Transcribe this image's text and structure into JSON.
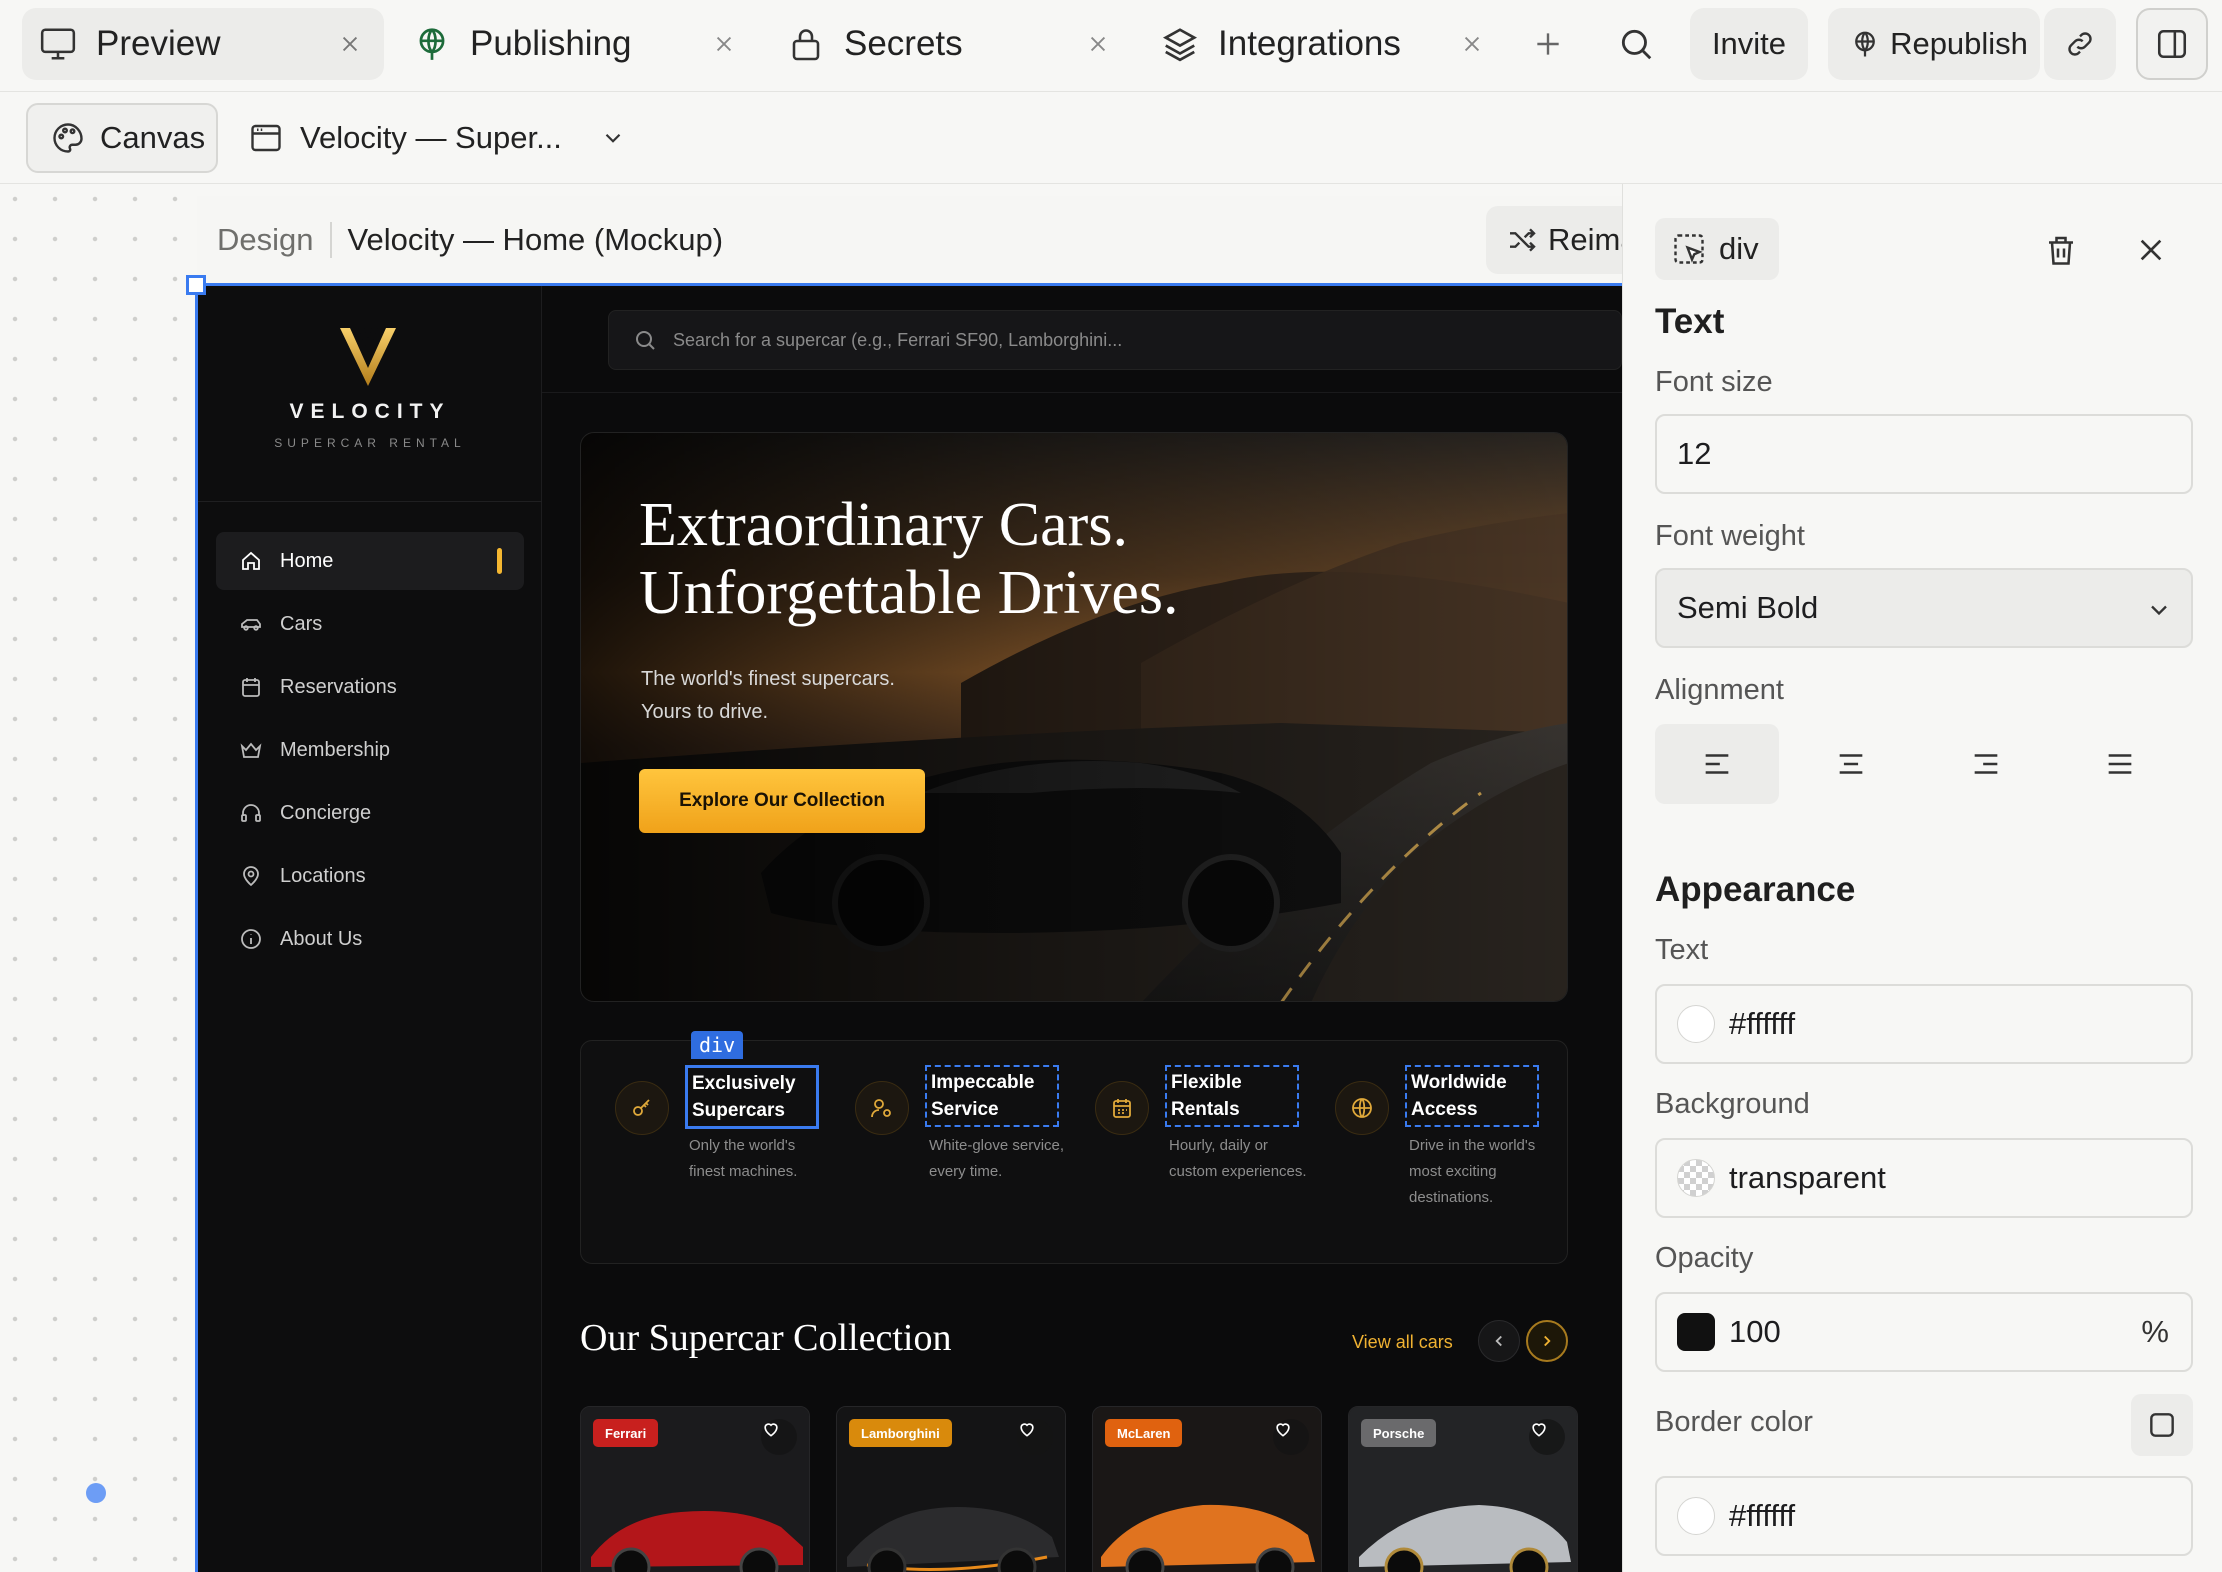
{
  "tabs": [
    {
      "label": "Preview",
      "icon": "monitor-icon",
      "active": true
    },
    {
      "label": "Publishing",
      "icon": "globe-icon",
      "active": false
    },
    {
      "label": "Secrets",
      "icon": "lock-icon",
      "active": false
    },
    {
      "label": "Integrations",
      "icon": "layers-icon",
      "active": false
    }
  ],
  "topbar": {
    "invite_label": "Invite",
    "republish_label": "Republish"
  },
  "subbar": {
    "canvas_label": "Canvas",
    "page_label": "Velocity — Super..."
  },
  "frame": {
    "crumb_parent": "Design",
    "crumb_current": "Velocity — Home (Mockup)",
    "reimagine_label": "Reima"
  },
  "site": {
    "brand_name": "VELOCITY",
    "brand_tagline": "SUPERCAR RENTAL",
    "accent_color": "#f5b731",
    "nav": [
      {
        "label": "Home",
        "icon": "home-icon",
        "active": true
      },
      {
        "label": "Cars",
        "icon": "car-icon",
        "active": false
      },
      {
        "label": "Reservations",
        "icon": "calendar-icon",
        "active": false
      },
      {
        "label": "Membership",
        "icon": "crown-icon",
        "active": false
      },
      {
        "label": "Concierge",
        "icon": "headphones-icon",
        "active": false
      },
      {
        "label": "Locations",
        "icon": "map-pin-icon",
        "active": false
      },
      {
        "label": "About Us",
        "icon": "info-icon",
        "active": false
      }
    ],
    "search_placeholder": "Search for a supercar (e.g., Ferrari SF90, Lamborghini...",
    "hero": {
      "title_line1": "Extraordinary Cars.",
      "title_line2": "Unforgettable Drives.",
      "subtitle_line1": "The world's finest supercars.",
      "subtitle_line2": "Yours to drive.",
      "cta_label": "Explore Our Collection"
    },
    "features": [
      {
        "title": "Exclusively Supercars",
        "desc": "Only the world's finest machines.",
        "icon": "key-icon"
      },
      {
        "title": "Impeccable Service",
        "desc": "White-glove service, every time.",
        "icon": "user-gear-icon"
      },
      {
        "title": "Flexible Rentals",
        "desc": "Hourly, daily or custom experiences.",
        "icon": "calendar-icon"
      },
      {
        "title": "Worldwide Access",
        "desc": "Drive in the world's most exciting destinations.",
        "icon": "globe-icon"
      }
    ],
    "selected_tag": "div",
    "collection_title": "Our Supercar Collection",
    "view_all_label": "View all cars",
    "cars": [
      {
        "brand": "Ferrari",
        "badge_color": "#c8201e",
        "body_color": "#b3161a"
      },
      {
        "brand": "Lamborghini",
        "badge_color": "#d98a0c",
        "body_color": "#2b2b2d"
      },
      {
        "brand": "McLaren",
        "badge_color": "#e0620f",
        "body_color": "#e0731f"
      },
      {
        "brand": "Porsche",
        "badge_color": "#6a6a6c",
        "body_color": "#b9bcc0"
      }
    ]
  },
  "inspector": {
    "element_tag": "div",
    "text_section": "Text",
    "font_size_label": "Font size",
    "font_size_value": "12",
    "font_weight_label": "Font weight",
    "font_weight_value": "Semi Bold",
    "alignment_label": "Alignment",
    "appearance_section": "Appearance",
    "text_color_label": "Text",
    "text_color_value": "#ffffff",
    "background_label": "Background",
    "background_value": "transparent",
    "opacity_label": "Opacity",
    "opacity_value": "100",
    "opacity_unit": "%",
    "border_color_label": "Border color",
    "border_color_value": "#ffffff"
  }
}
